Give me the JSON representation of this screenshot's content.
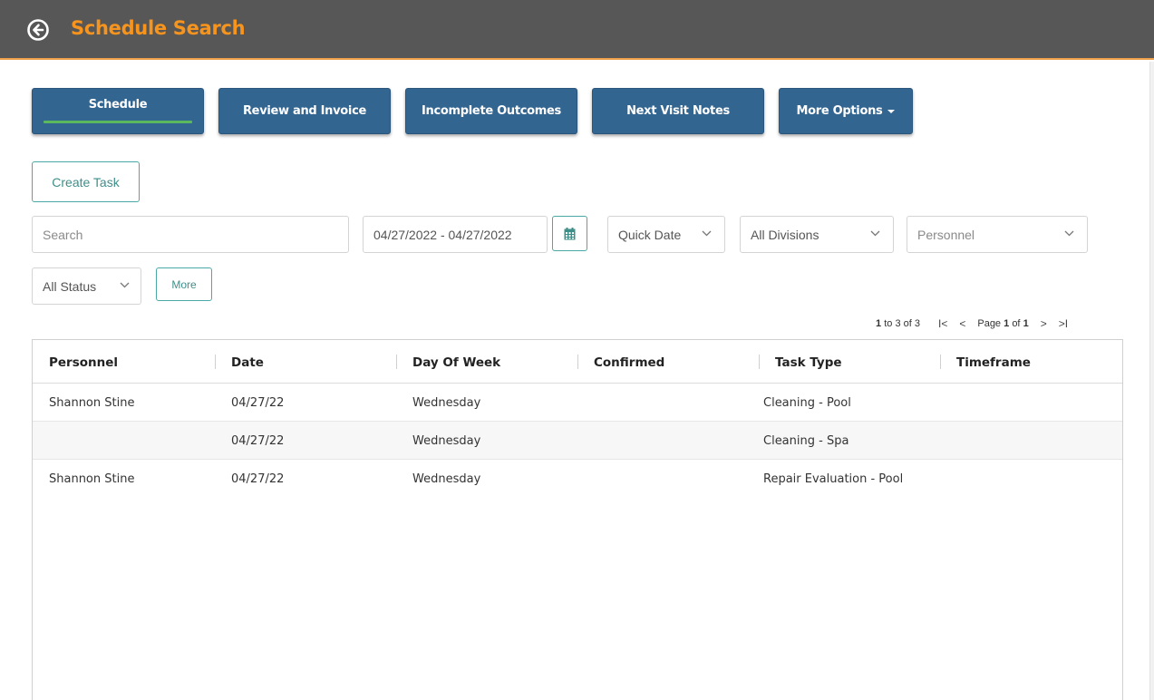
{
  "header": {
    "title": "Schedule Search",
    "back_icon": "arrow-circle-left-icon"
  },
  "tabs": [
    {
      "label": "Schedule",
      "active": true
    },
    {
      "label": "Review and Invoice",
      "active": false
    },
    {
      "label": "Incomplete Outcomes",
      "active": false
    },
    {
      "label": "Next Visit Notes",
      "active": false
    },
    {
      "label": "More Options",
      "active": false,
      "icon": "caret-down-icon"
    }
  ],
  "create_task_label": "Create Task",
  "filters": {
    "search_placeholder": "Search",
    "date_range": "04/27/2022 - 04/27/2022",
    "calendar_icon": "calendar-icon",
    "quick_date": "Quick Date",
    "divisions": "All Divisions",
    "personnel_placeholder": "Personnel",
    "status": "All Status",
    "more_label": "More"
  },
  "pager": {
    "from": "1",
    "to_text": "to",
    "to": "3",
    "of_text": "of",
    "total": "3",
    "page_text": "Page",
    "page": "1",
    "of2": "of",
    "pages": "1",
    "first": "I<",
    "prev": "<",
    "next": ">",
    "last": ">I"
  },
  "table": {
    "columns": [
      "Personnel",
      "Date",
      "Day Of Week",
      "Confirmed",
      "Task Type",
      "Timeframe"
    ],
    "rows": [
      [
        "Shannon Stine",
        "04/27/22",
        "Wednesday",
        "",
        "Cleaning - Pool",
        ""
      ],
      [
        "",
        "04/27/22",
        "Wednesday",
        "",
        "Cleaning - Spa",
        ""
      ],
      [
        "Shannon Stine",
        "04/27/22",
        "Wednesday",
        "",
        "Repair Evaluation - Pool",
        ""
      ]
    ]
  },
  "colors": {
    "header_bg": "#575757",
    "title": "#f7941d",
    "tab_bg": "#336591",
    "teal": "#4aa9a4",
    "active_line": "#5cb85c"
  }
}
